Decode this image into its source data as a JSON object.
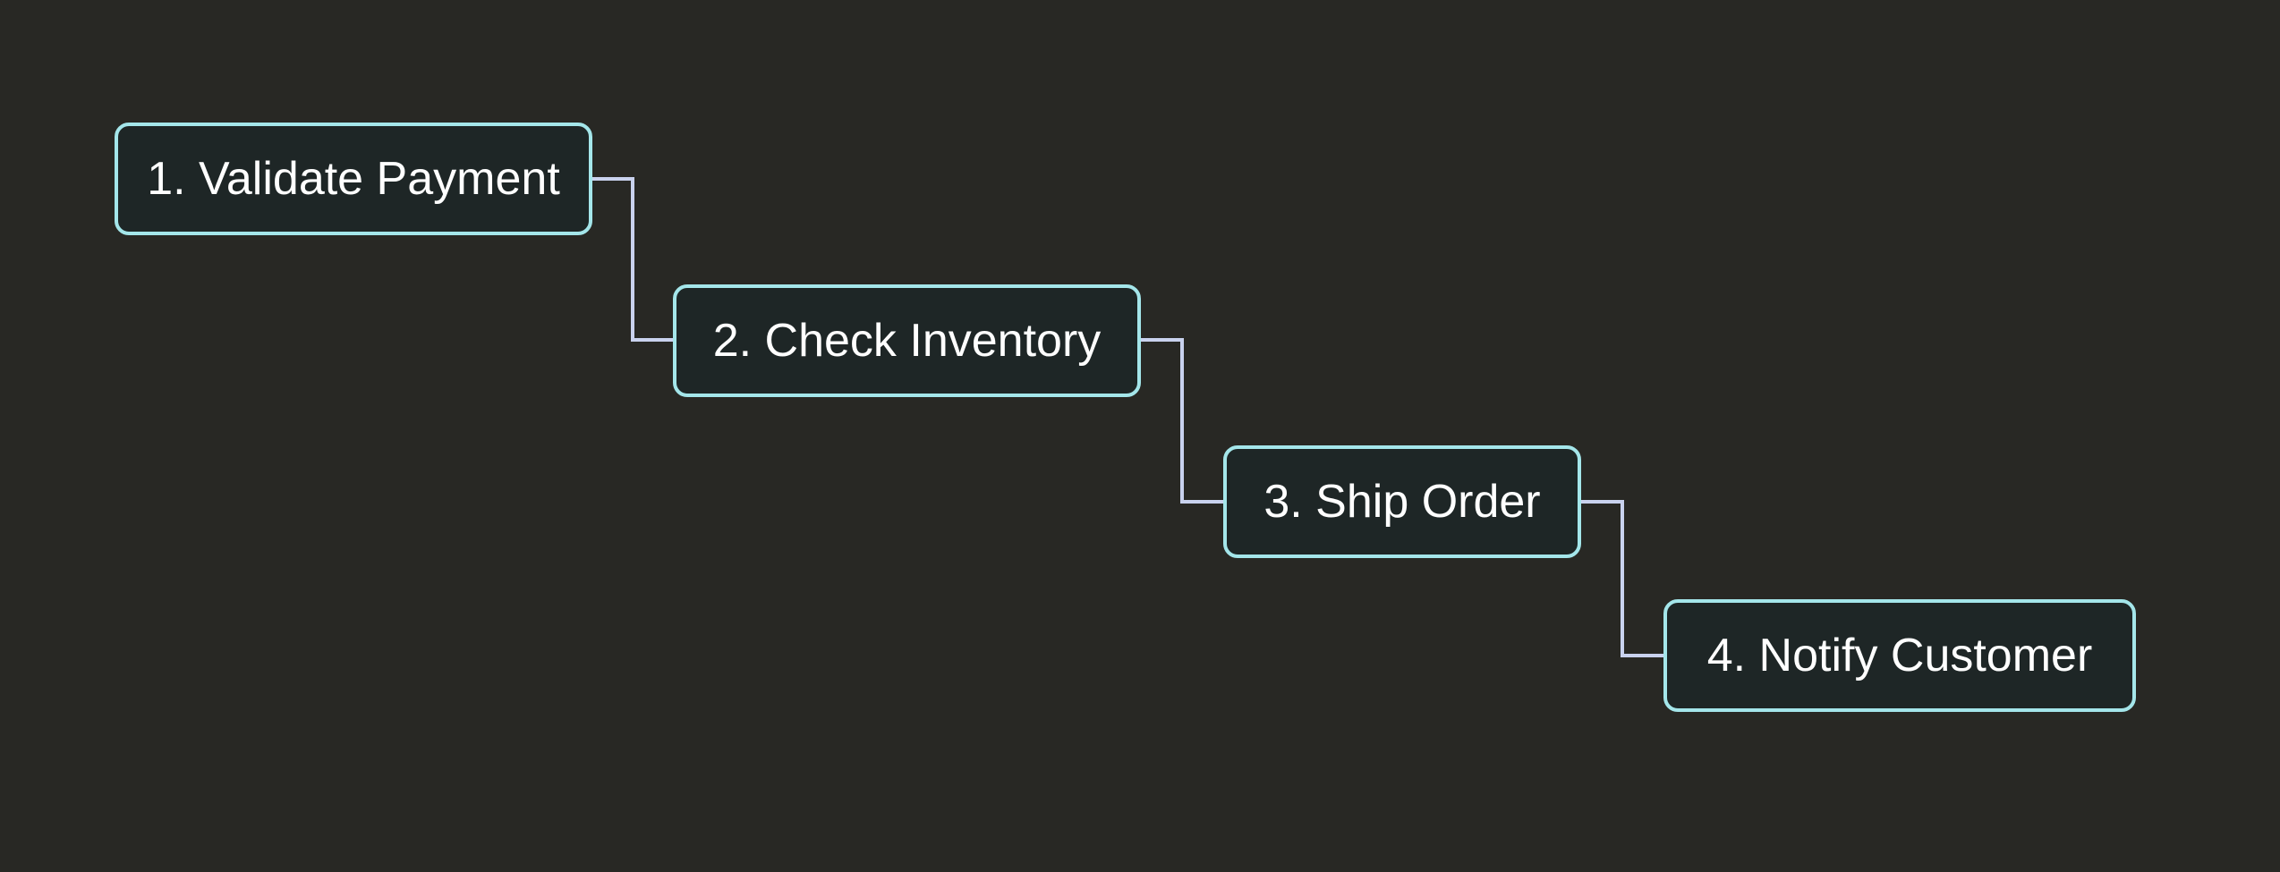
{
  "diagram": {
    "type": "flowchart",
    "background_color": "#282824",
    "node_fill_color": "#1e2626",
    "node_border_color": "#a4e6ea",
    "connector_color": "#c9d2ee",
    "text_color": "#ffffff",
    "nodes": [
      {
        "id": "n1",
        "label": "1. Validate Payment"
      },
      {
        "id": "n2",
        "label": "2. Check Inventory"
      },
      {
        "id": "n3",
        "label": "3. Ship Order"
      },
      {
        "id": "n4",
        "label": "4. Notify Customer"
      }
    ],
    "edges": [
      {
        "from": "n1",
        "to": "n2"
      },
      {
        "from": "n2",
        "to": "n3"
      },
      {
        "from": "n3",
        "to": "n4"
      }
    ]
  }
}
